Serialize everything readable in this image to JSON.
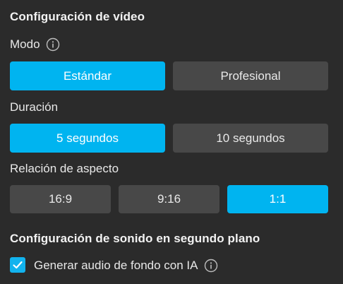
{
  "video_settings": {
    "title": "Configuración de vídeo",
    "mode_label": "Modo",
    "mode_options": [
      "Estándar",
      "Profesional"
    ],
    "mode_selected": "Estándar",
    "duration_label": "Duración",
    "duration_options": [
      "5 segundos",
      "10 segundos"
    ],
    "duration_selected": "5 segundos",
    "aspect_label": "Relación de aspecto",
    "aspect_options": [
      "16:9",
      "9:16",
      "1:1"
    ],
    "aspect_selected": "1:1"
  },
  "sound_settings": {
    "title": "Configuración de sonido en segundo plano",
    "checkbox_label": "Generar audio de fondo con IA",
    "checkbox_checked": true
  },
  "icons": {
    "info": "info-icon",
    "check": "check-icon"
  },
  "colors": {
    "background": "#2b2b2b",
    "accent": "#00b4f0",
    "button_inactive": "#484848"
  }
}
